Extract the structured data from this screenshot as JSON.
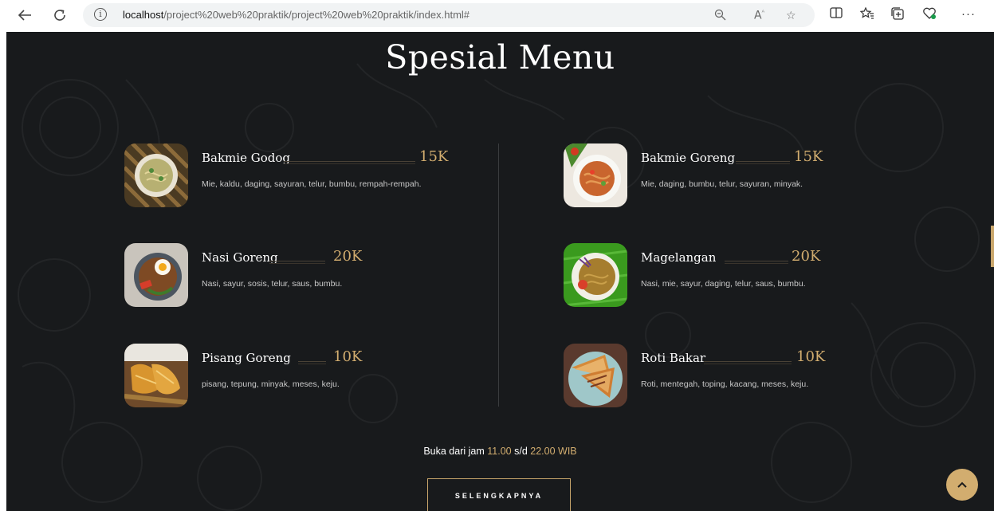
{
  "browser": {
    "url_host": "localhost",
    "url_path": "/project%20web%20praktik/project%20web%20praktik/index.html#"
  },
  "section": {
    "title": "Spesial Menu",
    "left_items": [
      {
        "name": "Bakmie Godog",
        "price": "15K",
        "desc": "Mie, kaldu, daging, sayuran, telur, bumbu, rempah-rempah."
      },
      {
        "name": "Nasi Goreng",
        "price": "20K",
        "desc": "Nasi, sayur, sosis, telur, saus, bumbu."
      },
      {
        "name": "Pisang Goreng",
        "price": "10K",
        "desc": "pisang, tepung, minyak, meses, keju."
      }
    ],
    "right_items": [
      {
        "name": "Bakmie Goreng",
        "price": "15K",
        "desc": "Mie, daging, bumbu, telur, sayuran, minyak."
      },
      {
        "name": "Magelangan",
        "price": "20K",
        "desc": "Nasi, mie, sayur, daging, telur, saus, bumbu."
      },
      {
        "name": "Roti Bakar",
        "price": "10K",
        "desc": "Roti, mentegah, toping, kacang, meses, keju."
      }
    ],
    "hours_prefix": "Buka dari jam",
    "hours_open": "11.00",
    "hours_mid": "s/d",
    "hours_close": "22.00 WIB",
    "more_button": "SELENGKAPNYA"
  },
  "colors": {
    "background": "#181a1c",
    "accent": "#d2ad6f"
  }
}
